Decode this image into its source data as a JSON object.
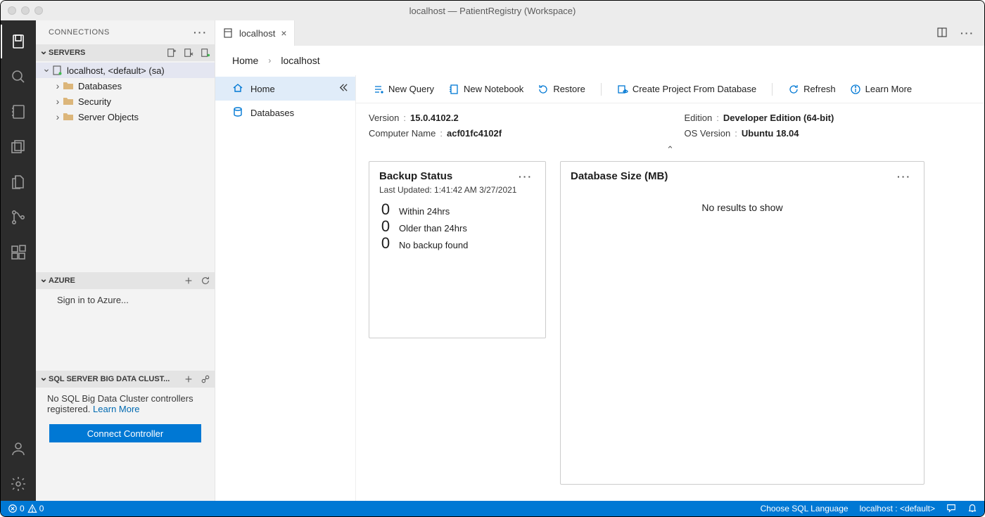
{
  "window": {
    "title": "localhost — PatientRegistry (Workspace)"
  },
  "sidebar": {
    "header": "CONNECTIONS",
    "sections": {
      "servers": {
        "title": "SERVERS",
        "root": "localhost, <default> (sa)",
        "children": [
          "Databases",
          "Security",
          "Server Objects"
        ]
      },
      "azure": {
        "title": "AZURE",
        "signin": "Sign in to Azure..."
      },
      "bigdata": {
        "title": "SQL SERVER BIG DATA CLUST...",
        "message": "No SQL Big Data Cluster controllers registered. ",
        "learn_more": "Learn More",
        "connect_btn": "Connect Controller"
      }
    }
  },
  "tab": {
    "label": "localhost"
  },
  "breadcrumb": {
    "home": "Home",
    "current": "localhost"
  },
  "nav": {
    "home": "Home",
    "databases": "Databases"
  },
  "toolbar": {
    "new_query": "New Query",
    "new_notebook": "New Notebook",
    "restore": "Restore",
    "create_project": "Create Project From Database",
    "refresh": "Refresh",
    "learn_more": "Learn More"
  },
  "info": {
    "version_k": "Version",
    "version_v": "15.0.4102.2",
    "computer_k": "Computer Name",
    "computer_v": "acf01fc4102f",
    "edition_k": "Edition",
    "edition_v": "Developer Edition (64-bit)",
    "os_k": "OS Version",
    "os_v": "Ubuntu 18.04"
  },
  "cards": {
    "backup": {
      "title": "Backup Status",
      "subtitle": "Last Updated: 1:41:42 AM 3/27/2021",
      "metrics": [
        {
          "value": "0",
          "label": "Within 24hrs"
        },
        {
          "value": "0",
          "label": "Older than 24hrs"
        },
        {
          "value": "0",
          "label": "No backup found"
        }
      ]
    },
    "dbsize": {
      "title": "Database Size (MB)",
      "empty": "No results to show"
    }
  },
  "statusbar": {
    "errors": "0",
    "warnings": "0",
    "lang": "Choose SQL Language",
    "conn": "localhost : <default>"
  }
}
